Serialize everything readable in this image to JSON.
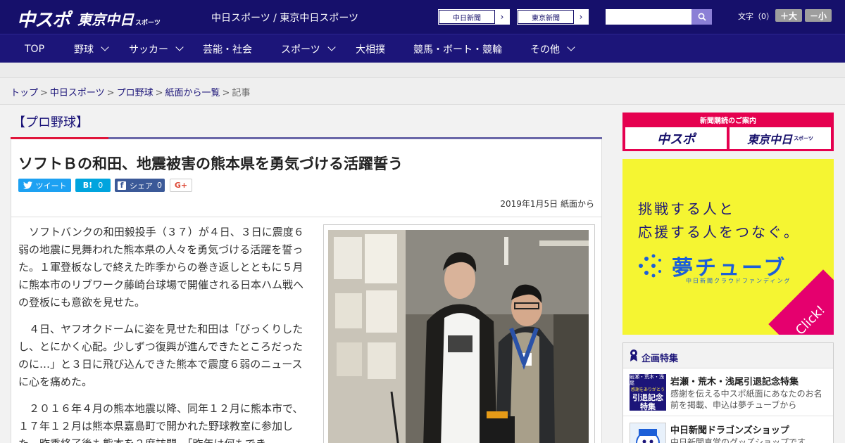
{
  "header": {
    "logo_chuspo": "中スポ",
    "logo_tokyo": "東京中日",
    "logo_tokyo_suffix": "スポーツ",
    "site_name": "中日スポーツ / 東京中日スポーツ",
    "links": [
      {
        "label": "中日新聞"
      },
      {
        "label": "東京新聞"
      }
    ],
    "search_placeholder": "",
    "font_size_label": "文字（0）",
    "font_bigger": "＋大",
    "font_smaller": "－小"
  },
  "nav": {
    "items": [
      {
        "label": "TOP",
        "has_menu": false
      },
      {
        "label": "野球",
        "has_menu": true
      },
      {
        "label": "サッカー",
        "has_menu": true
      },
      {
        "label": "芸能・社会",
        "has_menu": false
      },
      {
        "label": "スポーツ",
        "has_menu": true
      },
      {
        "label": "大相撲",
        "has_menu": false
      },
      {
        "label": "競馬・ボート・競輪",
        "has_menu": false
      },
      {
        "label": "その他",
        "has_menu": true
      }
    ]
  },
  "breadcrumb": {
    "items": [
      "トップ",
      "中日スポーツ",
      "プロ野球",
      "紙面から一覧"
    ],
    "current": "記事",
    "separator": ">"
  },
  "article": {
    "section": "【プロ野球】",
    "headline": "ソフトＢの和田、地震被害の熊本県を勇気づける活躍誓う",
    "share": {
      "twitter": "ツイート",
      "hatena": "B!",
      "hatena_count": "0",
      "facebook": "シェア",
      "facebook_count": "0",
      "gplus": "G+"
    },
    "date": "2019年1月5日 紙面から",
    "paragraphs": [
      "ソフトバンクの和田毅投手（３７）が４日、３日に震度６弱の地震に見舞われた熊本県の人々を勇気づける活躍を誓った。１軍登板なしで終えた昨季からの巻き返しとともに５月に熊本市のリブワーク藤崎台球場で開催される日本ハム戦への登板にも意欲を見せた。",
      "４日、ヤフオクドームに姿を見せた和田は「びっくりしたし、とにかく心配。少しずつ復興が進んできたところだったのに…」と３日に飛び込んできた熊本で震度６弱のニュースに心を痛めた。",
      "２０１６年４月の熊本地震以降、同年１２月に熊本市で、１７年１２月は熊本県嘉島町で開かれた野球教室に参加した。昨季終了後も熊本を２度訪問。「昨年は何もでき"
    ]
  },
  "sidebar": {
    "subscribe_title": "新聞購読のご案内",
    "subscribe_logos": [
      "中スポ",
      "東京中日"
    ],
    "subscribe_logo_suffix": "スポーツ",
    "ad": {
      "line1": "挑戦する人と",
      "line2": "応援する人をつなぐ。",
      "brand": "夢チューブ",
      "brand_sub": "中日新聞クラウドファンディング",
      "cta": "Click!"
    },
    "features": {
      "title": "企画特集",
      "items": [
        {
          "title": "岩瀬・荒木・浅尾引退記念特集",
          "desc": "感謝を伝える中スポ紙面にあなたのお名前を掲載、申込は夢チューブから",
          "thumb_lines": [
            "岩瀬・荒木・浅尾",
            "感謝をありがとう",
            "引退記念",
            "特集"
          ]
        },
        {
          "title": "中日新聞ドラゴンズショップ",
          "desc": "中日新聞直営のグッズショップです"
        }
      ]
    }
  },
  "colors": {
    "header_bg": "#16106b",
    "nav_bg": "#1c1579",
    "accent_red": "#e0153a",
    "accent_purple": "#6a67a8",
    "subscribe_bg": "#e5004f",
    "ad_bg": "#f5f532"
  }
}
